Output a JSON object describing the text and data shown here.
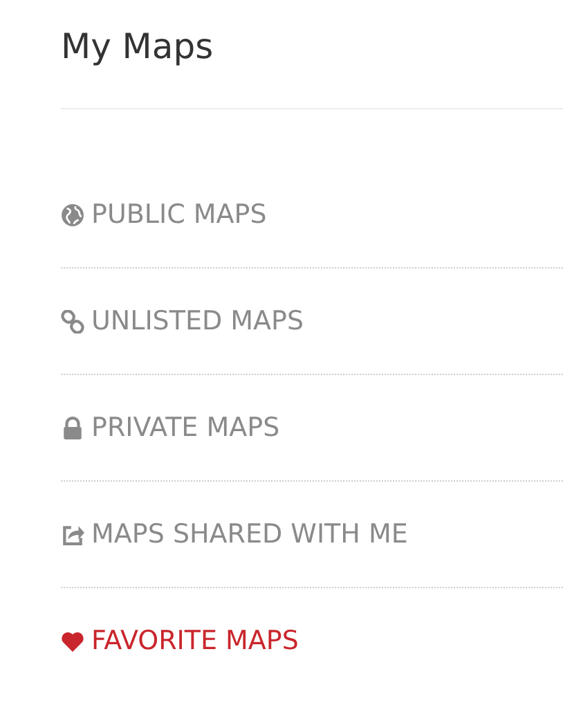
{
  "title": "My Maps",
  "items": [
    {
      "kind": "globe",
      "label": "PUBLIC MAPS",
      "selected": false
    },
    {
      "kind": "link",
      "label": "UNLISTED MAPS",
      "selected": false
    },
    {
      "kind": "lock",
      "label": "PRIVATE MAPS",
      "selected": false
    },
    {
      "kind": "share",
      "label": "MAPS SHARED WITH ME",
      "selected": false
    },
    {
      "kind": "heart",
      "label": "FAVORITE MAPS",
      "selected": true
    }
  ]
}
